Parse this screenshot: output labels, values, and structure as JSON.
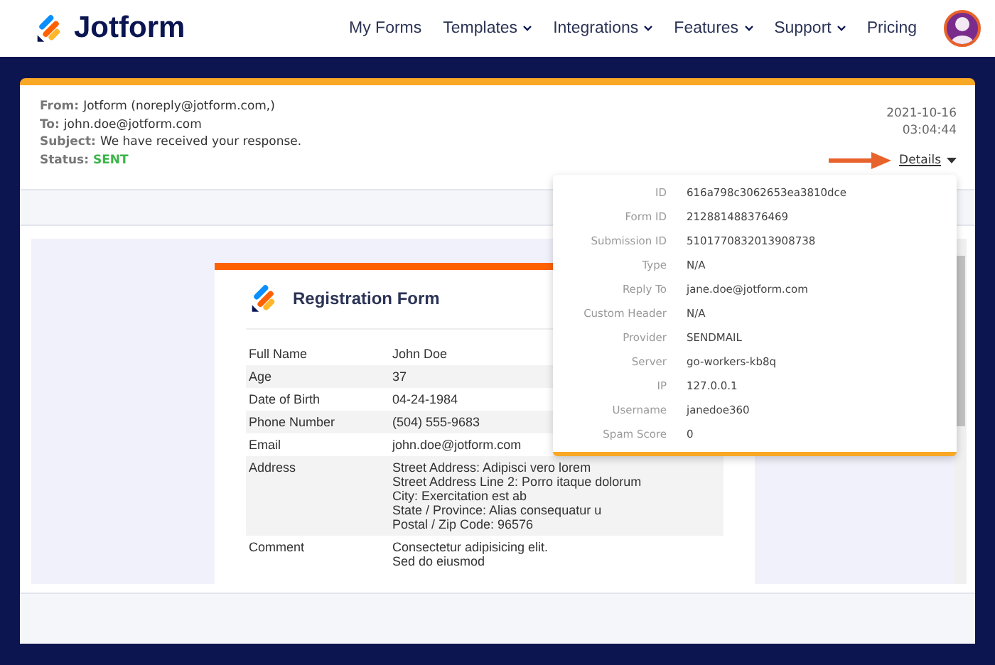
{
  "nav": {
    "brand": "Jotform",
    "items": [
      {
        "label": "My Forms",
        "dropdown": false
      },
      {
        "label": "Templates",
        "dropdown": true
      },
      {
        "label": "Integrations",
        "dropdown": true
      },
      {
        "label": "Features",
        "dropdown": true
      },
      {
        "label": "Support",
        "dropdown": true
      },
      {
        "label": "Pricing",
        "dropdown": false
      }
    ]
  },
  "email": {
    "fields": [
      {
        "label": "From:",
        "value": "Jotform (noreply@jotform.com,)",
        "kind": "plain"
      },
      {
        "label": "To:",
        "value": "john.doe@jotform.com",
        "kind": "plain"
      },
      {
        "label": "Subject:",
        "value": "We have received your response.",
        "kind": "plain"
      },
      {
        "label": "Status:",
        "value": "SENT",
        "kind": "status"
      }
    ],
    "date": "2021-10-16",
    "time": "03:04:44",
    "details_link": "Details"
  },
  "details_popup": {
    "rows": [
      {
        "label": "ID",
        "value": "616a798c3062653ea3810dce"
      },
      {
        "label": "Form ID",
        "value": "212881488376469"
      },
      {
        "label": "Submission ID",
        "value": "5101770832013908738"
      },
      {
        "label": "Type",
        "value": "N/A"
      },
      {
        "label": "Reply To",
        "value": "jane.doe@jotform.com"
      },
      {
        "label": "Custom Header",
        "value": "N/A"
      },
      {
        "label": "Provider",
        "value": "SENDMAIL"
      },
      {
        "label": "Server",
        "value": "go-workers-kb8q"
      },
      {
        "label": "IP",
        "value": "127.0.0.1"
      },
      {
        "label": "Username",
        "value": "janedoe360"
      },
      {
        "label": "Spam Score",
        "value": "0"
      }
    ]
  },
  "form": {
    "title": "Registration Form",
    "rows": [
      {
        "label": "Full Name",
        "lines": [
          "John Doe"
        ]
      },
      {
        "label": "Age",
        "lines": [
          "37"
        ]
      },
      {
        "label": "Date of Birth",
        "lines": [
          "04-24-1984"
        ]
      },
      {
        "label": "Phone Number",
        "lines": [
          "(504) 555-9683"
        ]
      },
      {
        "label": "Email",
        "lines": [
          "john.doe@jotform.com"
        ]
      },
      {
        "label": "Address",
        "lines": [
          "Street Address: Adipisci vero lorem",
          "Street Address Line 2: Porro itaque dolorum",
          "City: Exercitation est ab",
          "State / Province: Alias consequatur u",
          "Postal / Zip Code: 96576"
        ]
      },
      {
        "label": "Comment",
        "lines": [
          "Consectetur adipisicing elit.",
          "Sed do eiusmod"
        ]
      }
    ]
  }
}
